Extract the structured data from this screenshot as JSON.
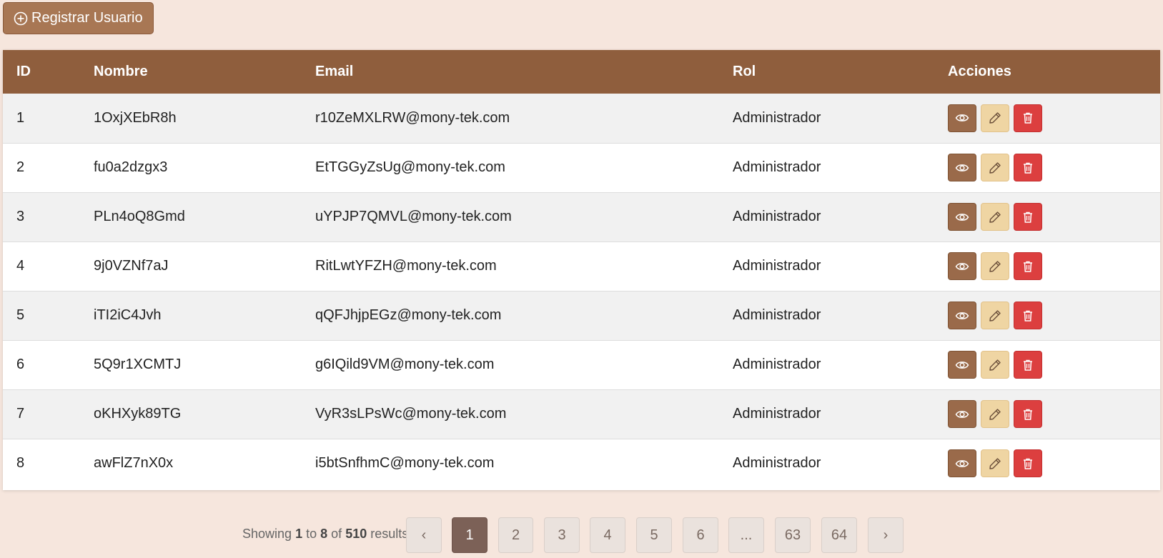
{
  "toolbar": {
    "register_label": "Registrar Usuario"
  },
  "table": {
    "headers": {
      "id": "ID",
      "name": "Nombre",
      "email": "Email",
      "rol": "Rol",
      "actions": "Acciones"
    },
    "rows": [
      {
        "id": "1",
        "name": "1OxjXEbR8h",
        "email": "r10ZeMXLRW@mony-tek.com",
        "rol": "Administrador"
      },
      {
        "id": "2",
        "name": "fu0a2dzgx3",
        "email": "EtTGGyZsUg@mony-tek.com",
        "rol": "Administrador"
      },
      {
        "id": "3",
        "name": "PLn4oQ8Gmd",
        "email": "uYPJP7QMVL@mony-tek.com",
        "rol": "Administrador"
      },
      {
        "id": "4",
        "name": "9j0VZNf7aJ",
        "email": "RitLwtYFZH@mony-tek.com",
        "rol": "Administrador"
      },
      {
        "id": "5",
        "name": "iTI2iC4Jvh",
        "email": "qQFJhjpEGz@mony-tek.com",
        "rol": "Administrador"
      },
      {
        "id": "6",
        "name": "5Q9r1XCMTJ",
        "email": "g6IQild9VM@mony-tek.com",
        "rol": "Administrador"
      },
      {
        "id": "7",
        "name": "oKHXyk89TG",
        "email": "VyR3sLPsWc@mony-tek.com",
        "rol": "Administrador"
      },
      {
        "id": "8",
        "name": "awFlZ7nX0x",
        "email": "i5btSnfhmC@mony-tek.com",
        "rol": "Administrador"
      }
    ],
    "row_actions": [
      "eye-icon",
      "pencil-icon",
      "trash-icon"
    ]
  },
  "pagination": {
    "showing_prefix": "Showing",
    "from": "1",
    "to_word": "to",
    "to": "8",
    "of_word": "of",
    "total": "510",
    "suffix": "results",
    "prev": "‹",
    "next": "›",
    "pages": [
      "1",
      "2",
      "3",
      "4",
      "5",
      "6",
      "...",
      "63",
      "64"
    ],
    "current": "1"
  },
  "colors": {
    "background": "#f6e6dd",
    "header": "#8f5e3d",
    "view_button": "#9a6a4a",
    "edit_button": "#efd5a3",
    "delete_button": "#dc3f3f",
    "active_page": "#7c6157"
  }
}
